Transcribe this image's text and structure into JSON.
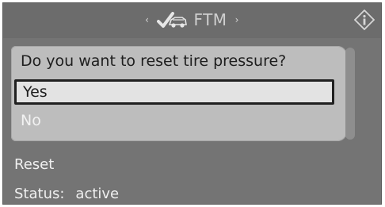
{
  "header": {
    "left_arrow": "‹",
    "title": "FTM",
    "right_arrow": "›",
    "car_icon": "tire-pressure-check-car-icon",
    "info_icon": "info-icon"
  },
  "dialog": {
    "question": "Do you want to reset tire pressure?",
    "options": [
      {
        "label": "Yes",
        "selected": true
      },
      {
        "label": "No",
        "selected": false
      }
    ]
  },
  "footer": {
    "reset_label": "Reset",
    "status_label": "Status:",
    "status_value": "active"
  },
  "colors": {
    "screen_bg": "#747474",
    "dialog_bg": "#bdbdbd",
    "selection_border": "#202020"
  }
}
